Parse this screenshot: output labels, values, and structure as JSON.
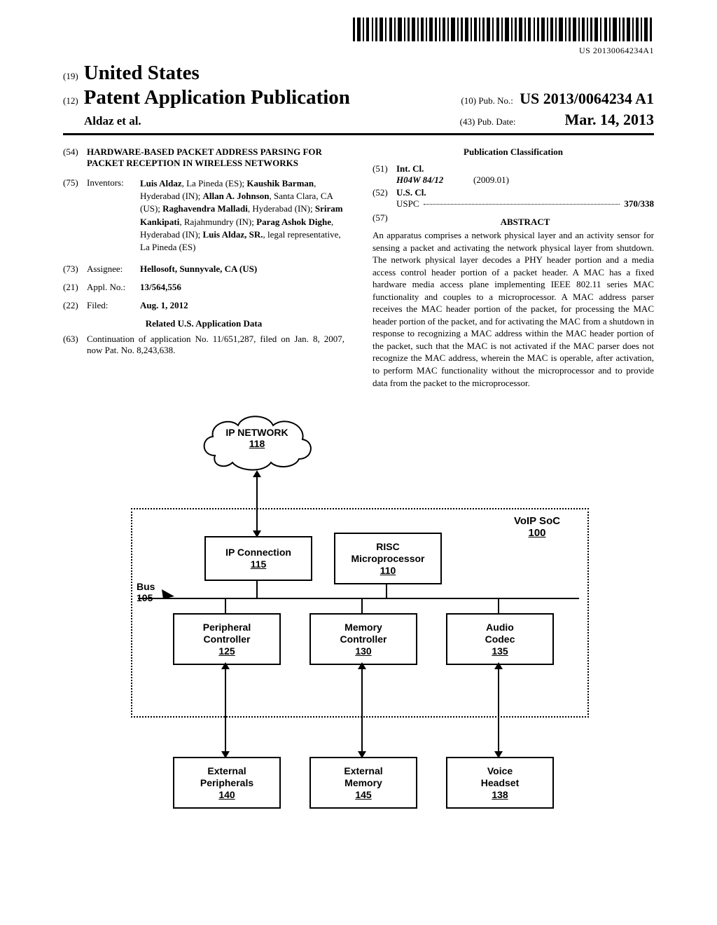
{
  "barcode_number": "US 20130064234A1",
  "header": {
    "code19": "(19)",
    "country": "United States",
    "code12": "(12)",
    "doc_type": "Patent Application Publication",
    "code10": "(10)",
    "pubno_label": "Pub. No.:",
    "pubno_value": "US 2013/0064234 A1",
    "authors_line": "Aldaz et al.",
    "code43": "(43)",
    "pubdate_label": "Pub. Date:",
    "pubdate_value": "Mar. 14, 2013"
  },
  "left_col": {
    "code54": "(54)",
    "title": "HARDWARE-BASED PACKET ADDRESS PARSING FOR PACKET RECEPTION IN WIRELESS NETWORKS",
    "code75": "(75)",
    "inventors_label": "Inventors:",
    "inventors_html": "Luis Aldaz, La Pineda (ES); Kaushik Barman, Hyderabad (IN); Allan A. Johnson, Santa Clara, CA (US); Raghavendra Malladi, Hyderabad (IN); Sriram Kankipati, Rajahmundry (IN); Parag Ashok Dighe, Hyderabad (IN); Luis Aldaz, SR., legal representative, La Pineda (ES)",
    "code73": "(73)",
    "assignee_label": "Assignee:",
    "assignee_value": "Hellosoft, Sunnyvale, CA (US)",
    "code21": "(21)",
    "applno_label": "Appl. No.:",
    "applno_value": "13/564,556",
    "code22": "(22)",
    "filed_label": "Filed:",
    "filed_value": "Aug. 1, 2012",
    "related_heading": "Related U.S. Application Data",
    "code63": "(63)",
    "related_text": "Continuation of application No. 11/651,287, filed on Jan. 8, 2007, now Pat. No. 8,243,638."
  },
  "right_col": {
    "pub_class_heading": "Publication Classification",
    "code51": "(51)",
    "intcl_label": "Int. Cl.",
    "intcl_code": "H04W 84/12",
    "intcl_year": "(2009.01)",
    "code52": "(52)",
    "uscl_label": "U.S. Cl.",
    "uspc_label": "USPC",
    "uspc_value": "370/338",
    "code57": "(57)",
    "abstract_heading": "ABSTRACT",
    "abstract_text": "An apparatus comprises a network physical layer and an activity sensor for sensing a packet and activating the network physical layer from shutdown. The network physical layer decodes a PHY header portion and a media access control header portion of a packet header. A MAC has a fixed hardware media access plane implementing IEEE 802.11 series MAC functionality and couples to a microprocessor. A MAC address parser receives the MAC header portion of the packet, for processing the MAC header portion of the packet, and for activating the MAC from a shutdown in response to recognizing a MAC address within the MAC header portion of the packet, such that the MAC is not activated if the MAC parser does not recognize the MAC address, wherein the MAC is operable, after activation, to perform MAC functionality without the microprocessor and to provide data from the packet to the microprocessor."
  },
  "diagram": {
    "cloud": {
      "label": "IP NETWORK",
      "ref": "118"
    },
    "soc_label": "VoIP SoC",
    "soc_ref": "100",
    "ip_conn": {
      "label": "IP Connection",
      "ref": "115"
    },
    "risc": {
      "label1": "RISC",
      "label2": "Microprocessor",
      "ref": "110"
    },
    "bus_label": "Bus",
    "bus_ref": "105",
    "periph_ctrl": {
      "label1": "Peripheral",
      "label2": "Controller",
      "ref": "125"
    },
    "mem_ctrl": {
      "label1": "Memory",
      "label2": "Controller",
      "ref": "130"
    },
    "audio_codec": {
      "label1": "Audio",
      "label2": "Codec",
      "ref": "135"
    },
    "ext_periph": {
      "label1": "External",
      "label2": "Peripherals",
      "ref": "140"
    },
    "ext_mem": {
      "label1": "External",
      "label2": "Memory",
      "ref": "145"
    },
    "headset": {
      "label1": "Voice",
      "label2": "Headset",
      "ref": "138"
    }
  }
}
